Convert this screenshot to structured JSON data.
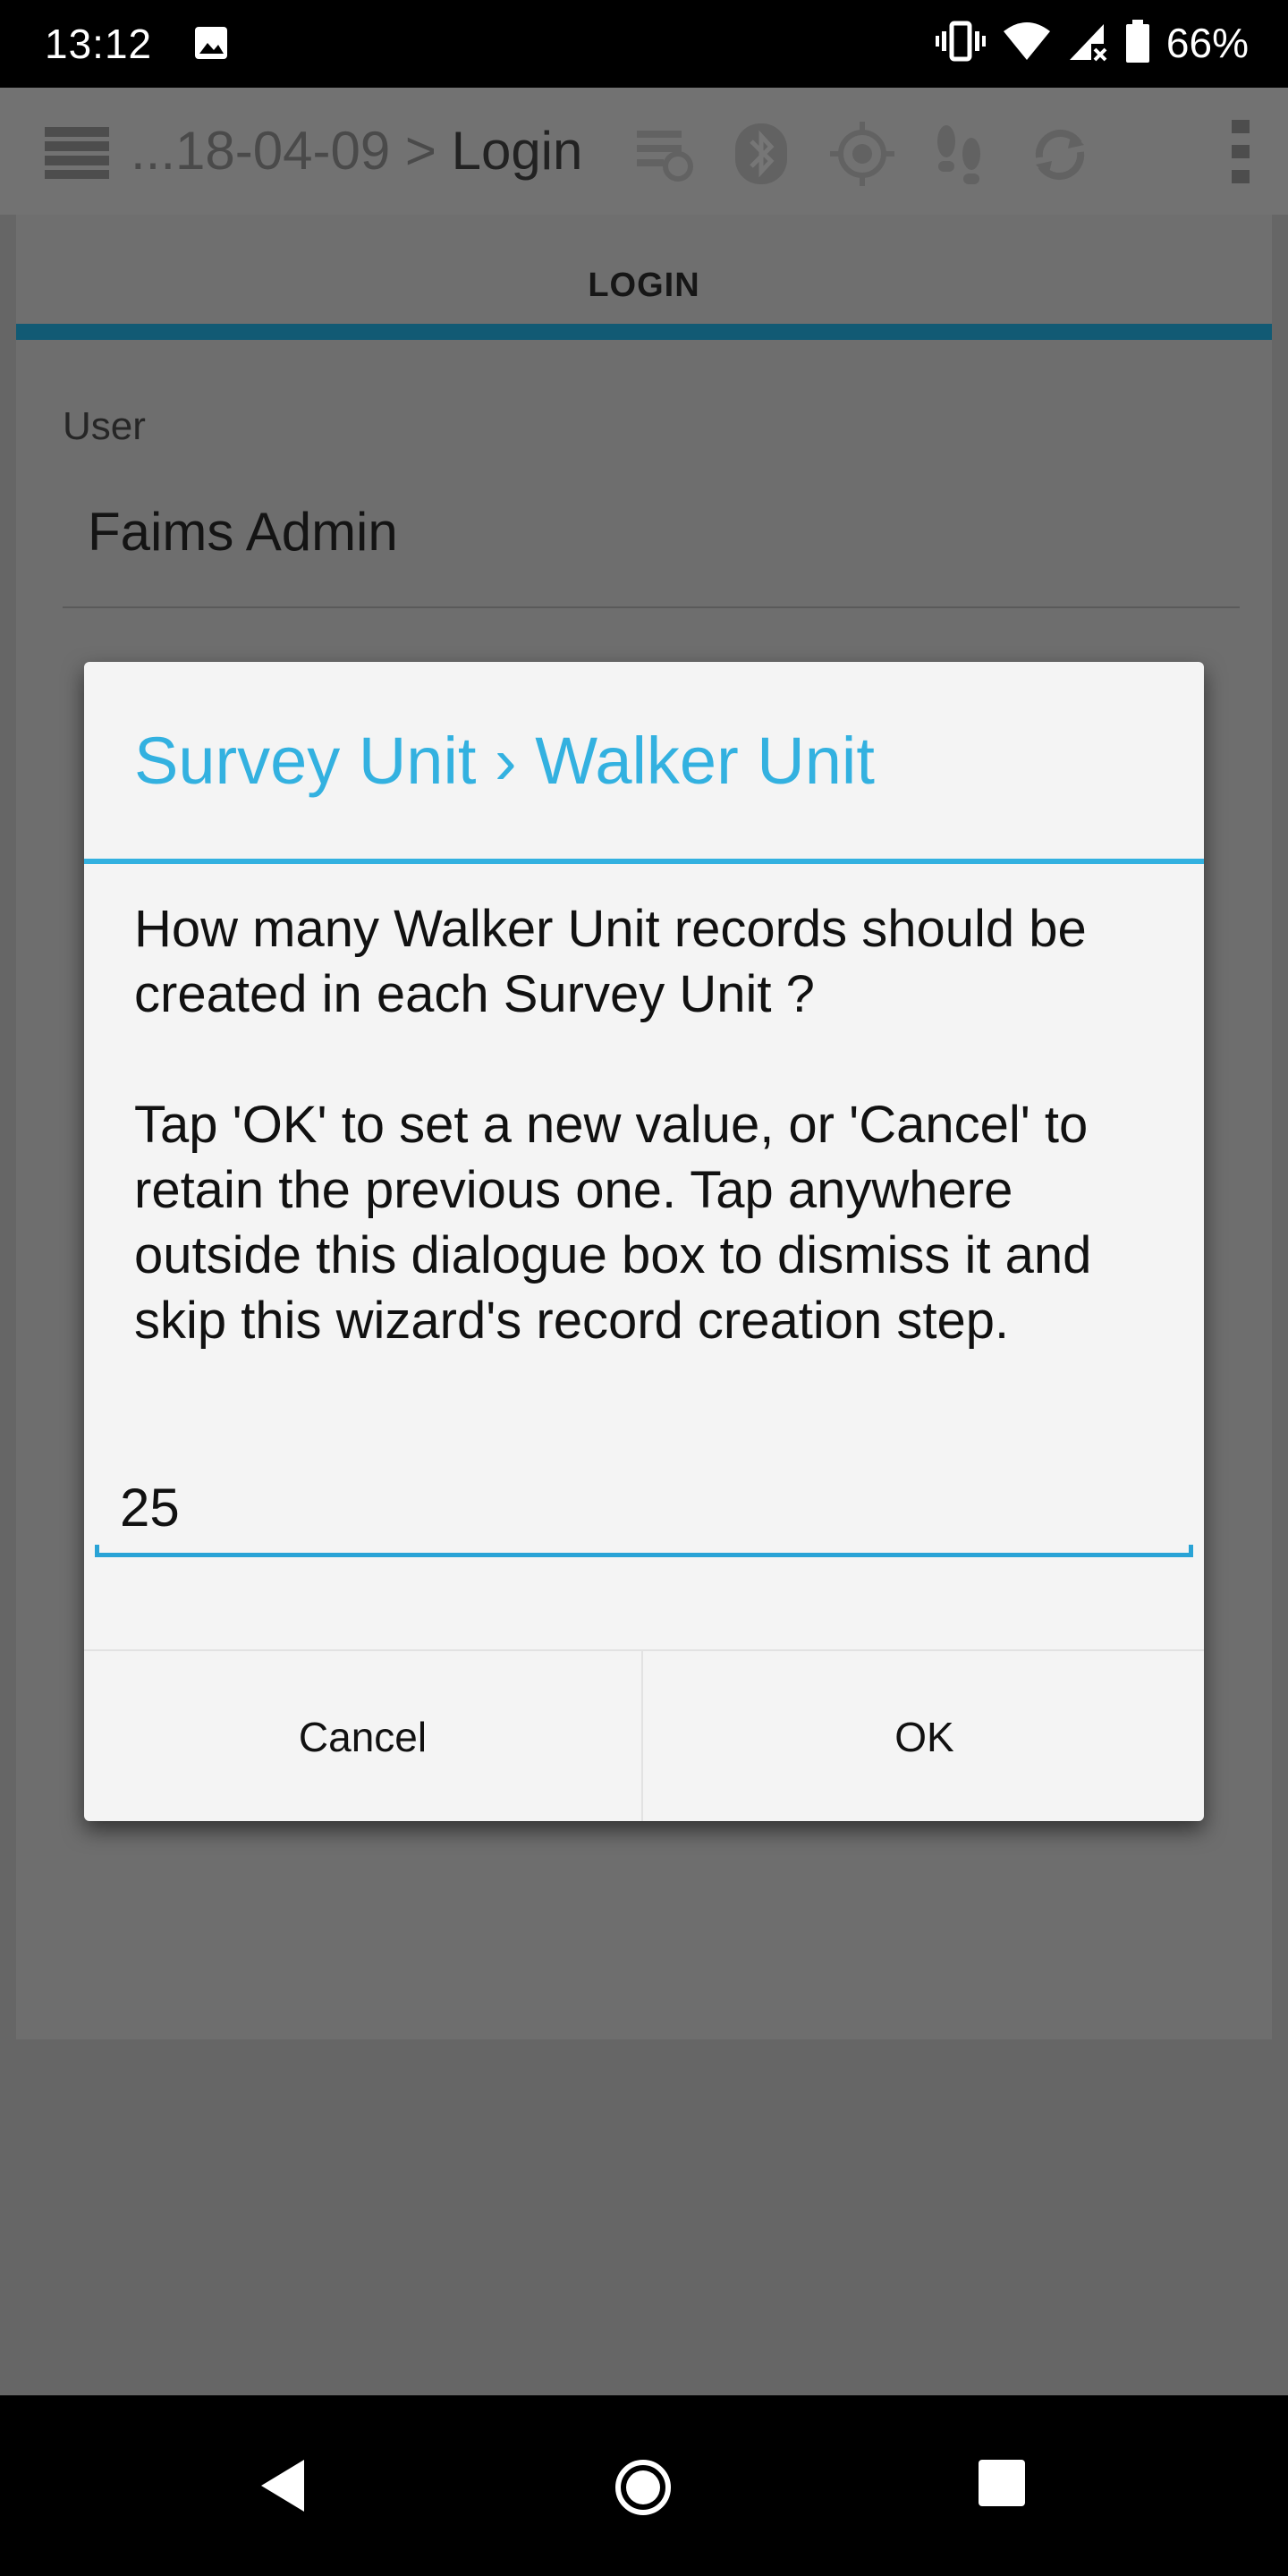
{
  "status_bar": {
    "time": "13:12",
    "battery": "66%"
  },
  "toolbar": {
    "breadcrumb_path": "...18-04-09 >",
    "breadcrumb_current": "Login"
  },
  "tab": {
    "label": "LOGIN"
  },
  "form": {
    "user_label": "User",
    "user_value": "Faims Admin"
  },
  "dialog": {
    "title": "Survey Unit › Walker Unit",
    "question": "How many Walker Unit records should be created in each Survey Unit ?",
    "instructions": "Tap 'OK' to set a new value, or 'Cancel' to retain the previous one. Tap anywhere outside this dialogue box to dismiss it and skip this wizard's record creation step.",
    "input_value": "25",
    "cancel_label": "Cancel",
    "ok_label": "OK"
  },
  "colors": {
    "accent": "#33b1e0",
    "tab_indicator": "#125a74"
  },
  "icons": [
    "image-icon",
    "vibrate-icon",
    "wifi-icon",
    "cell-signal-icon",
    "battery-icon",
    "menu-icon",
    "sync-status-icon",
    "bluetooth-icon",
    "gps-icon",
    "tracking-icon",
    "sync-icon",
    "overflow-menu-icon",
    "back-icon",
    "home-icon",
    "recents-icon"
  ]
}
